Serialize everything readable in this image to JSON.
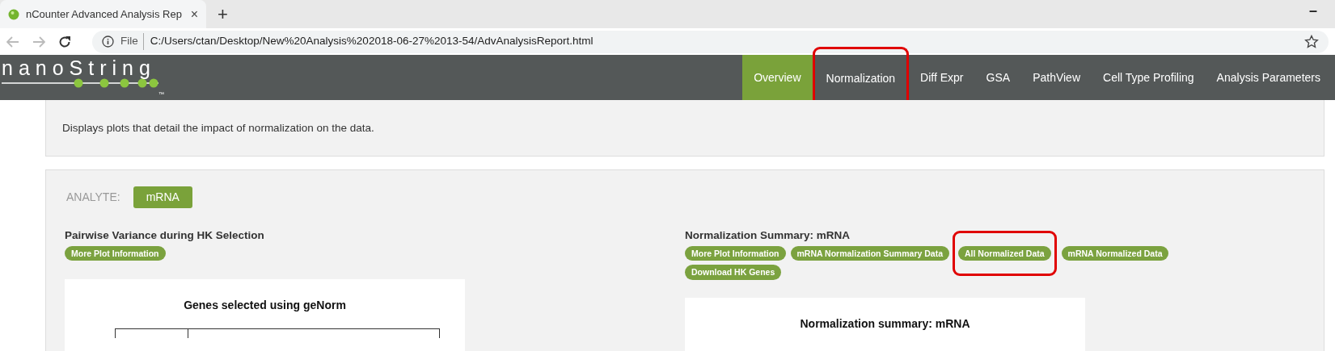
{
  "browser": {
    "tab_title": "nCounter Advanced Analysis Rep",
    "tab_close": "×",
    "new_tab": "+",
    "minimize": "–",
    "address_scheme": "File",
    "address_url": "C:/Users/ctan/Desktop/New%20Analysis%202018-06-27%2013-54/AdvAnalysisReport.html"
  },
  "navbar": {
    "logo": "nanoString",
    "trademark": "™",
    "items": [
      {
        "label": "Overview",
        "selected": true,
        "highlighted": false
      },
      {
        "label": "Normalization",
        "selected": false,
        "highlighted": true
      },
      {
        "label": "Diff Expr",
        "selected": false,
        "highlighted": false
      },
      {
        "label": "GSA",
        "selected": false,
        "highlighted": false
      },
      {
        "label": "PathView",
        "selected": false,
        "highlighted": false
      },
      {
        "label": "Cell Type Profiling",
        "selected": false,
        "highlighted": false
      },
      {
        "label": "Analysis Parameters",
        "selected": false,
        "highlighted": false
      }
    ]
  },
  "intro": "Displays plots that detail the impact of normalization on the data.",
  "analyte": {
    "label": "ANALYTE:",
    "value": "mRNA"
  },
  "panels": [
    {
      "title": "Pairwise Variance during HK Selection",
      "buttons": [
        {
          "label": "More Plot Information",
          "highlighted": false
        }
      ],
      "plot_title": "Genes selected using geNorm",
      "has_table": true
    },
    {
      "title": "Normalization Summary: mRNA",
      "buttons": [
        {
          "label": "More Plot Information",
          "highlighted": false
        },
        {
          "label": "mRNA Normalization Summary Data",
          "highlighted": false
        },
        {
          "label": "All Normalized Data",
          "highlighted": true
        },
        {
          "label": "mRNA Normalized Data",
          "highlighted": false
        },
        {
          "label": "Download HK Genes",
          "highlighted": false
        }
      ],
      "plot_title": "Normalization summary: mRNA",
      "has_table": false
    }
  ]
}
